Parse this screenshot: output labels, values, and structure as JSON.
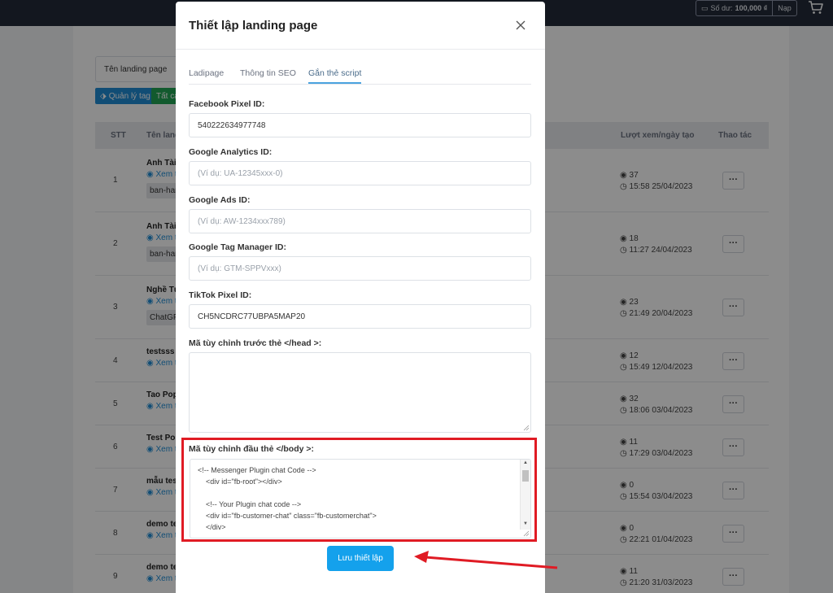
{
  "topbar": {
    "balance_label": "Số dư:",
    "balance_value": "100,000 ₫",
    "topup_label": "Nạp",
    "cart_icon": "cart-icon"
  },
  "background": {
    "filter_placeholder": "Tên landing page",
    "btn_tag_label": "Quản lý tag",
    "btn_all_label": "Tất cả",
    "table_headers": {
      "stt": "STT",
      "name": "Tên land",
      "views_date": "Lượt xem/ngày tạo",
      "actions": "Thao tác"
    },
    "rows": [
      {
        "stt": "1",
        "name": "Anh Tài -",
        "view": "Xem t",
        "tag": "ban-han",
        "views": "37",
        "date": "15:58 25/04/2023"
      },
      {
        "stt": "2",
        "name": "Anh Tài",
        "view": "Xem t",
        "tag": "ban-han",
        "views": "18",
        "date": "11:27 24/04/2023"
      },
      {
        "stt": "3",
        "name": "Nghề Tư",
        "view": "Xem t",
        "tag": "ChatGP",
        "views": "23",
        "date": "21:49 20/04/2023"
      },
      {
        "stt": "4",
        "name": "testsss",
        "view": "Xem t",
        "tag": "",
        "views": "12",
        "date": "15:49 12/04/2023"
      },
      {
        "stt": "5",
        "name": "Tao Pop",
        "view": "Xem t",
        "tag": "",
        "views": "32",
        "date": "18:06 03/04/2023"
      },
      {
        "stt": "6",
        "name": "Test Pop",
        "view": "Xem t",
        "tag": "",
        "views": "11",
        "date": "17:29 03/04/2023"
      },
      {
        "stt": "7",
        "name": "mẫu test",
        "view": "Xem t",
        "tag": "",
        "views": "0",
        "date": "15:54 03/04/2023"
      },
      {
        "stt": "8",
        "name": "demo te",
        "view": "Xem t",
        "tag": "",
        "views": "0",
        "date": "22:21 01/04/2023"
      },
      {
        "stt": "9",
        "name": "demo te",
        "view": "Xem t",
        "tag": "",
        "views": "11",
        "date": "21:20 31/03/2023"
      }
    ],
    "action_label": "···"
  },
  "modal": {
    "title": "Thiết lập landing page",
    "tabs": [
      "Ladipage",
      "Thông tin SEO",
      "Gắn thẻ script"
    ],
    "active_tab": "Gắn thẻ script",
    "fields": {
      "fb_pixel": {
        "label": "Facebook Pixel ID:",
        "value": "540222634977748"
      },
      "ga": {
        "label": "Google Analytics ID:",
        "placeholder": "(Ví dụ: UA-12345xxx-0)"
      },
      "gads": {
        "label": "Google Ads ID:",
        "placeholder": "(Ví dụ: AW-1234xxx789)"
      },
      "gtm": {
        "label": "Google Tag Manager ID:",
        "placeholder": "(Ví dụ: GTM-SPPVxxx)"
      },
      "tiktok": {
        "label": "TikTok Pixel ID:",
        "value": "CH5NCDRC77UBPA5MAP20"
      },
      "head_code": {
        "label": "Mã tùy chỉnh trước thẻ </head >:"
      },
      "body_code": {
        "label": "Mã tùy chỉnh đầu thẻ </body >:",
        "lines": [
          "<!-- Messenger Plugin chat Code -->",
          "    <div id=\"fb-root\"></div>",
          "",
          "    <!-- Your Plugin chat code -->",
          "    <div id=\"fb-customer-chat\" class=\"fb-customerchat\">",
          "    </div>"
        ]
      }
    },
    "save_label": "Lưu thiết lập"
  },
  "colors": {
    "accent": "#14a1ec",
    "highlight": "#e01b24",
    "topbar": "#242b3a"
  }
}
